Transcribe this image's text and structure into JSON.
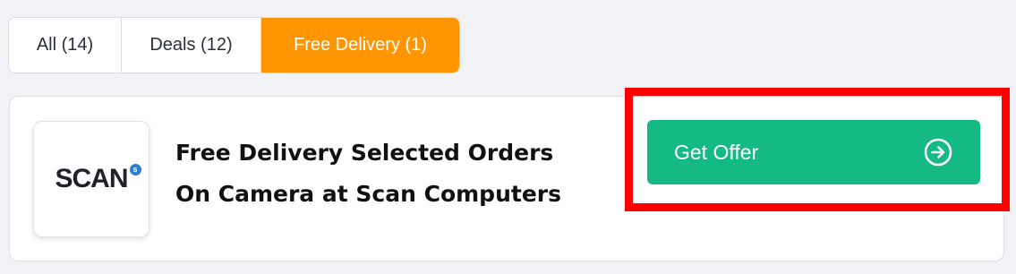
{
  "tabs": [
    {
      "label": "All (14)",
      "active": false
    },
    {
      "label": "Deals (12)",
      "active": false
    },
    {
      "label": "Free Delivery (1)",
      "active": true
    }
  ],
  "offer": {
    "logo_text": "SCAN",
    "logo_badge": "s",
    "title_line1": "Free Delivery Selected Orders",
    "title_line2": "On Camera at Scan Computers",
    "button_label": "Get Offer",
    "button_icon": "arrow-circle-right-icon"
  },
  "colors": {
    "active_tab": "#ff9500",
    "button": "#14b983",
    "highlight": "#ff0000"
  }
}
